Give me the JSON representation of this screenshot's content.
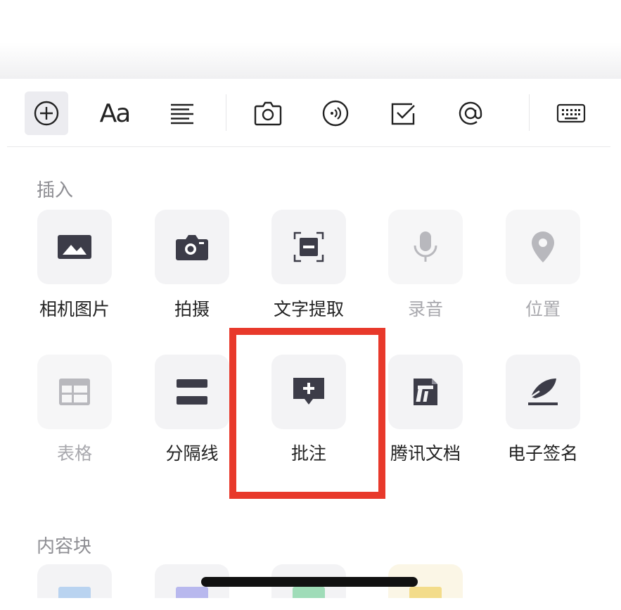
{
  "toolbar": {
    "items": [
      {
        "icon": "plus-circle-icon",
        "active": true
      },
      {
        "icon": "font-style-icon",
        "text": "Aa"
      },
      {
        "icon": "align-text-icon"
      },
      {
        "icon": "camera-icon"
      },
      {
        "icon": "voice-icon"
      },
      {
        "icon": "checkbox-icon"
      },
      {
        "icon": "at-mention-icon"
      },
      {
        "icon": "keyboard-icon"
      }
    ]
  },
  "insert_section": {
    "title": "插入",
    "row1": [
      {
        "label": "相机图片",
        "icon": "image-icon",
        "enabled": true
      },
      {
        "label": "拍摄",
        "icon": "camera-icon",
        "enabled": true
      },
      {
        "label": "文字提取",
        "icon": "text-scan-icon",
        "enabled": true
      },
      {
        "label": "录音",
        "icon": "microphone-icon",
        "enabled": false
      },
      {
        "label": "位置",
        "icon": "location-pin-icon",
        "enabled": false
      }
    ],
    "row2": [
      {
        "label": "表格",
        "icon": "table-icon",
        "enabled": false
      },
      {
        "label": "分隔线",
        "icon": "divider-icon",
        "enabled": true
      },
      {
        "label": "批注",
        "icon": "annotation-icon",
        "enabled": true,
        "highlighted": true
      },
      {
        "label": "腾讯文档",
        "icon": "tencent-docs-icon",
        "enabled": true
      },
      {
        "label": "电子签名",
        "icon": "signature-icon",
        "enabled": true
      }
    ]
  },
  "content_block_section": {
    "title": "内容块"
  },
  "colors": {
    "highlight": "#e8392b",
    "icon_dark": "#3c3c48",
    "icon_dim": "#b8b8bd",
    "tile_bg": "#f3f3f5"
  }
}
